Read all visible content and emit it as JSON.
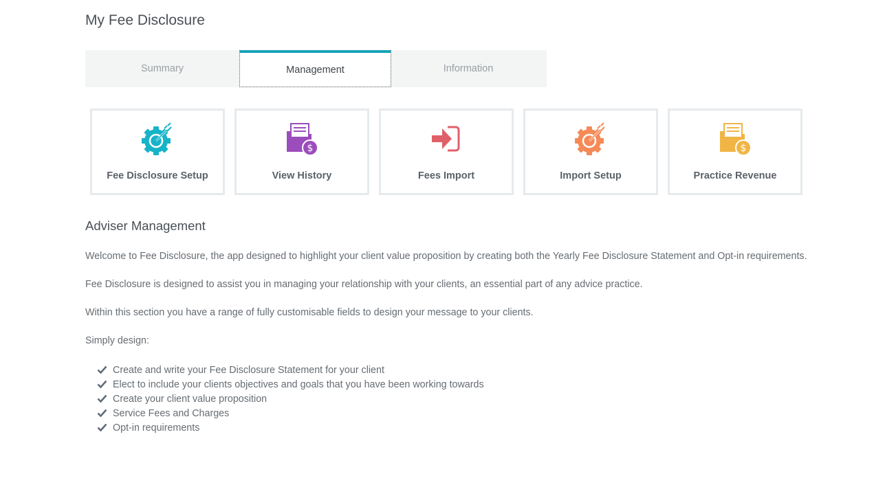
{
  "page": {
    "title": "My Fee Disclosure"
  },
  "tabs": [
    {
      "label": "Summary",
      "active": false
    },
    {
      "label": "Management",
      "active": true
    },
    {
      "label": "Information",
      "active": false
    }
  ],
  "tiles": [
    {
      "label": "Fee Disclosure Setup",
      "icon": "gear-target-icon",
      "color": "#17b3c9"
    },
    {
      "label": "View History",
      "icon": "folder-dollar-icon",
      "color": "#9b4dbb"
    },
    {
      "label": "Fees Import",
      "icon": "import-arrow-icon",
      "color": "#e0606a"
    },
    {
      "label": "Import Setup",
      "icon": "gear-target-icon",
      "color": "#f58a57"
    },
    {
      "label": "Practice Revenue",
      "icon": "folder-dollar-icon",
      "color": "#f0b545"
    }
  ],
  "section": {
    "title": "Adviser Management",
    "paragraphs": [
      "Welcome to Fee Disclosure, the app designed to highlight your client value proposition by creating both the Yearly Fee Disclosure Statement and Opt-in requirements.",
      "Fee Disclosure is designed to assist you in managing your relationship with your clients, an essential part of any advice practice.",
      "Within this section you have a range of fully customisable fields to design your message to your clients.",
      "Simply design:"
    ],
    "checklist": [
      "Create and write your Fee Disclosure Statement for your client",
      "Elect to include your clients objectives and goals that you have been working towards",
      "Create your client value proposition",
      "Service Fees and Charges",
      "Opt-in requirements"
    ]
  },
  "colors": {
    "accent": "#17a2b8",
    "tile_border": "#e6eaed",
    "tab_bg": "#f3f4f4"
  }
}
